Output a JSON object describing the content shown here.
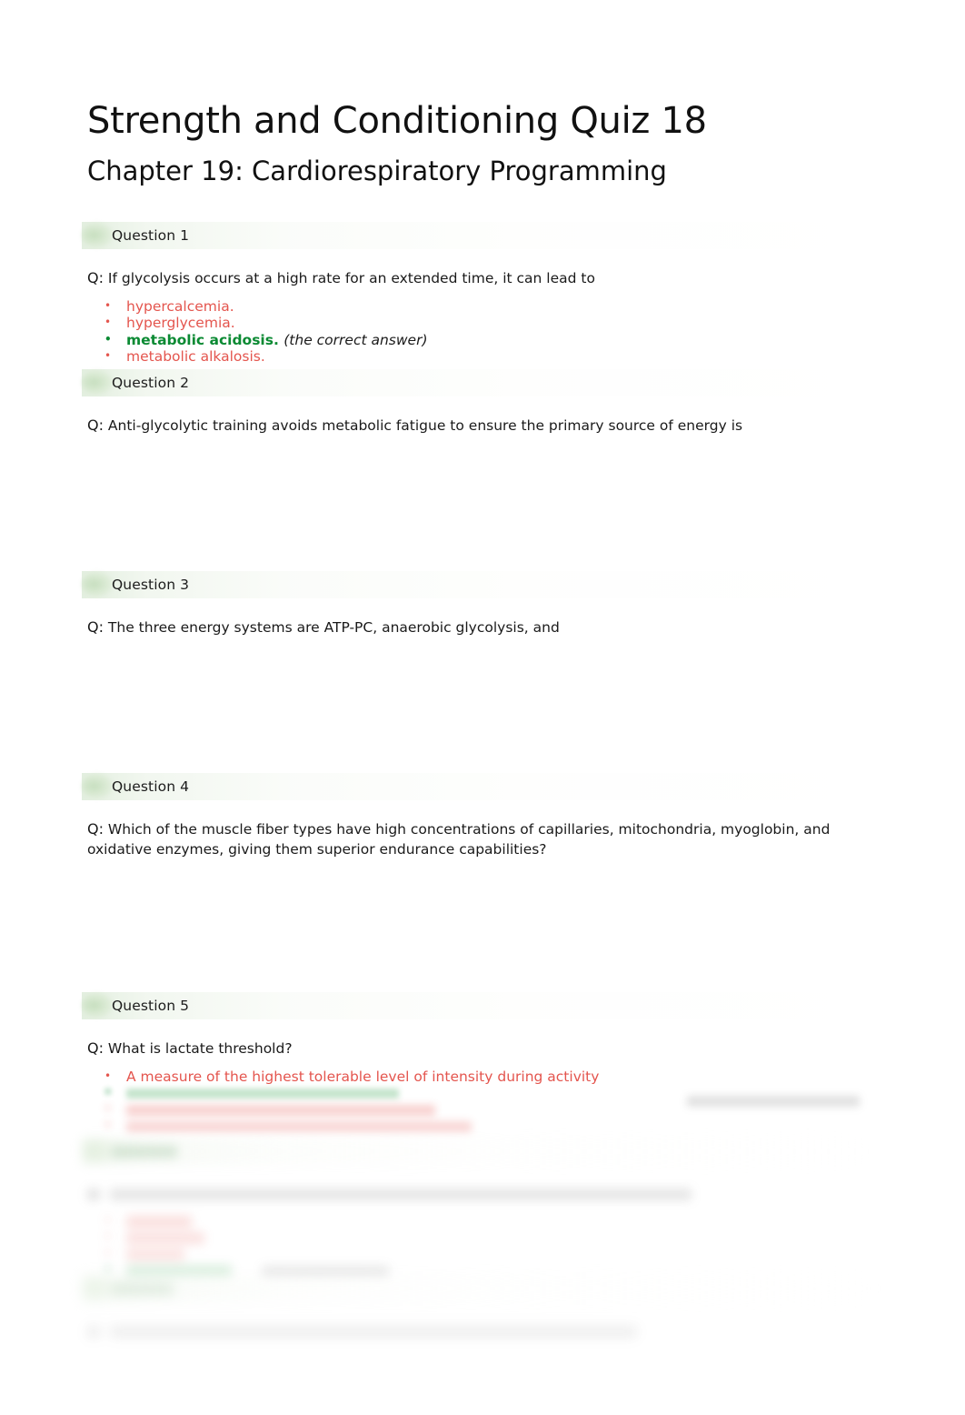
{
  "document": {
    "title": "Strength and Conditioning Quiz 18",
    "subtitle": "Chapter 19: Cardiorespiratory Programming",
    "question_prefix": "Q:",
    "correct_answer_note": "(the correct answer)"
  },
  "questions": [
    {
      "header": "Question 1",
      "text": "If glycolysis occurs at a high rate for an extended time, it can lead to",
      "options": [
        {
          "label": "hypercalcemia.",
          "correct": false
        },
        {
          "label": "hyperglycemia.",
          "correct": false
        },
        {
          "label": "metabolic acidosis.",
          "correct": true
        },
        {
          "label": "metabolic alkalosis.",
          "correct": false
        }
      ],
      "blur": 0
    },
    {
      "header": "Question 2",
      "text": "Anti-glycolytic training avoids metabolic fatigue to ensure the primary source of energy is",
      "options": [],
      "blur": 0
    },
    {
      "header": "Question 3",
      "text": "The three energy systems are ATP-PC, anaerobic glycolysis, and",
      "options": [],
      "blur": 0
    },
    {
      "header": "Question 4",
      "text": "Which of the muscle fiber types have high concentrations of capillaries, mitochondria, myoglobin, and oxidative enzymes, giving them superior endurance capabilities?",
      "options": [],
      "blur": 0
    },
    {
      "header": "Question 5",
      "text": "What is lactate threshold?",
      "options": [
        {
          "label": "A measure of the highest tolerable level of intensity during activity",
          "correct": false
        },
        {
          "label": "",
          "correct": true
        },
        {
          "label": "",
          "correct": false
        },
        {
          "label": "",
          "correct": false
        }
      ],
      "blur": 2
    },
    {
      "header": "",
      "text": "",
      "options": [
        {
          "label": "",
          "correct": false
        },
        {
          "label": "",
          "correct": false
        },
        {
          "label": "",
          "correct": true
        }
      ],
      "blur": 4
    },
    {
      "header": "",
      "text": "",
      "options": [],
      "blur": 5
    }
  ]
}
